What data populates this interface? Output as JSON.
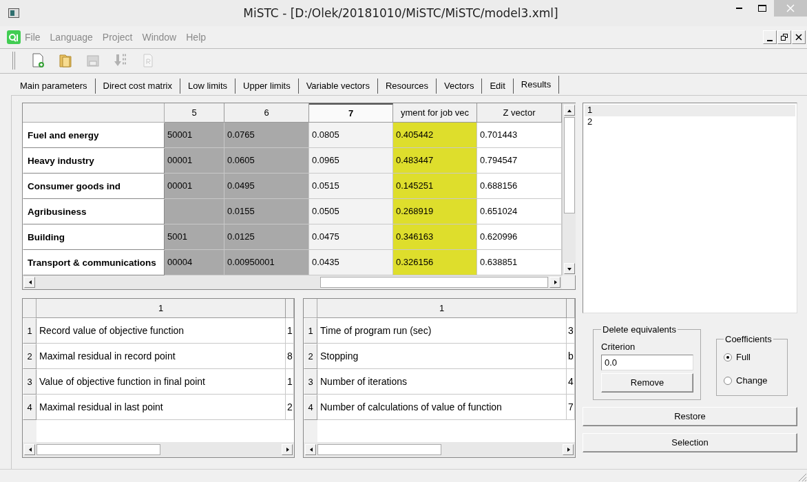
{
  "window": {
    "title": "MiSTC - [D:/Olek/20181010/MiSTC/MiSTC/model3.xml]"
  },
  "menu": [
    "File",
    "Language",
    "Project",
    "Window",
    "Help"
  ],
  "toolbar": [
    {
      "kind": "new",
      "disabled": false
    },
    {
      "kind": "open",
      "disabled": false
    },
    {
      "kind": "save",
      "disabled": true
    },
    {
      "kind": "import",
      "disabled": true
    },
    {
      "kind": "report",
      "disabled": true
    }
  ],
  "tabs": [
    {
      "label": "Main parameters",
      "selected": false
    },
    {
      "label": "Direct cost matrix",
      "selected": false
    },
    {
      "label": "Low limits",
      "selected": false
    },
    {
      "label": "Upper limits",
      "selected": false
    },
    {
      "label": "Variable vectors",
      "selected": false
    },
    {
      "label": "Resources",
      "selected": false
    },
    {
      "label": "Vectors",
      "selected": false
    },
    {
      "label": "Edit",
      "selected": false
    },
    {
      "label": "Results",
      "selected": true
    }
  ],
  "table": {
    "columns": [
      {
        "label": "5",
        "color": "#a9a9a9",
        "selected": false
      },
      {
        "label": "6",
        "color": "#a9a9a9",
        "selected": false
      },
      {
        "label": "7",
        "color": "#f3f3f3",
        "selected": true
      },
      {
        "label": "yment for job vec",
        "color": "#dede2c",
        "selected": false
      },
      {
        "label": "Z vector",
        "color": "#ffffff",
        "selected": false
      }
    ],
    "rows": [
      {
        "label": "Fuel and energy",
        "cells": [
          "50001",
          "0.0765",
          "0.0805",
          "0.405442",
          "0.701443"
        ]
      },
      {
        "label": "Heavy industry",
        "cells": [
          "00001",
          "0.0605",
          "0.0965",
          "0.483447",
          "0.794547"
        ]
      },
      {
        "label": "Consumer goods ind",
        "cells": [
          "00001",
          "0.0495",
          "0.0515",
          "0.145251",
          "0.688156"
        ]
      },
      {
        "label": "Agribusiness",
        "cells": [
          null,
          "0.0155",
          "0.0505",
          "0.268919",
          "0.651024"
        ]
      },
      {
        "label": "Building",
        "cells": [
          "5001",
          "0.0125",
          "0.0475",
          "0.346163",
          "0.620996"
        ]
      },
      {
        "label": "Transport & communications",
        "cells": [
          "00004",
          "0.00950001",
          "0.0435",
          "0.326156",
          "0.638851"
        ]
      }
    ]
  },
  "results": [
    {
      "header": "1",
      "rows": [
        {
          "number": "1",
          "label": "Record value of objective function",
          "value": "1"
        },
        {
          "number": "2",
          "label": "Maximal residual in record point",
          "value": "8"
        },
        {
          "number": "3",
          "label": "Value of objective function in final point",
          "value": "1"
        },
        {
          "number": "4",
          "label": "Maximal residual in last point",
          "value": "2"
        }
      ]
    },
    {
      "header": "1",
      "rows": [
        {
          "number": "1",
          "label": "Time of program run (sec)",
          "value": "3"
        },
        {
          "number": "2",
          "label": "Stopping",
          "value": "b"
        },
        {
          "number": "3",
          "label": "Number of iterations",
          "value": "4"
        },
        {
          "number": "4",
          "label": "Number of calculations of value of function",
          "value": "7"
        }
      ]
    }
  ],
  "list": [
    {
      "label": "1",
      "selected": true
    },
    {
      "label": "2",
      "selected": false
    }
  ],
  "delete_equivalents": {
    "title": "Delete equivalents",
    "criterion_label": "Criterion",
    "criterion_value": "0.0",
    "button": "Remove"
  },
  "coefficients": {
    "title": "Coefficients",
    "options": [
      {
        "label": "Full",
        "selected": true
      },
      {
        "label": "Change",
        "selected": false
      }
    ]
  },
  "buttons": [
    "Restore",
    "Selection"
  ]
}
